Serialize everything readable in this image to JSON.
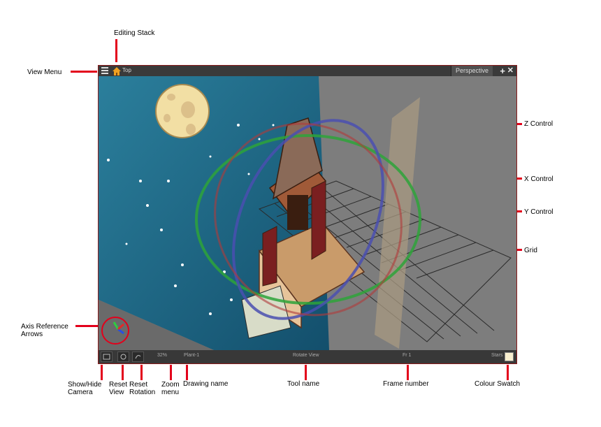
{
  "callouts": {
    "editing_stack": "Editing Stack",
    "view_menu": "View Menu",
    "z_control": "Z Control",
    "x_control": "X Control",
    "y_control": "Y Control",
    "grid": "Grid",
    "axis_reference": "Axis Reference\nArrows",
    "show_hide_camera": "Show/Hide\nCamera",
    "reset_view": "Reset\nView",
    "reset_rotation": "Reset\nRotation",
    "zoom_menu": "Zoom\nmenu",
    "drawing_name": "Drawing name",
    "tool_name": "Tool name",
    "frame_number": "Frame number",
    "colour_swatch": "Colour Swatch"
  },
  "window": {
    "stack_label": "Top",
    "view_tab": "Perspective"
  },
  "status_bar": {
    "zoom": "32%",
    "drawing": "Plant-1",
    "tool": "Rotate View",
    "frame": "Fr 1",
    "swatch_name": "Stars"
  },
  "colors": {
    "callout_line": "#e3001b",
    "sky": "#1f6a8a",
    "grid_floor": "#7a7a7a",
    "swatch": "#f8efcf",
    "z_ring": "#4a4fb0",
    "x_ring": "#b03a3a",
    "y_ring": "#2ea33a"
  },
  "icons": [
    "view-menu-icon",
    "home-icon",
    "add-icon",
    "close-icon",
    "camera-icon",
    "reset-view-icon",
    "reset-rotation-icon",
    "axis-arrows-icon"
  ]
}
